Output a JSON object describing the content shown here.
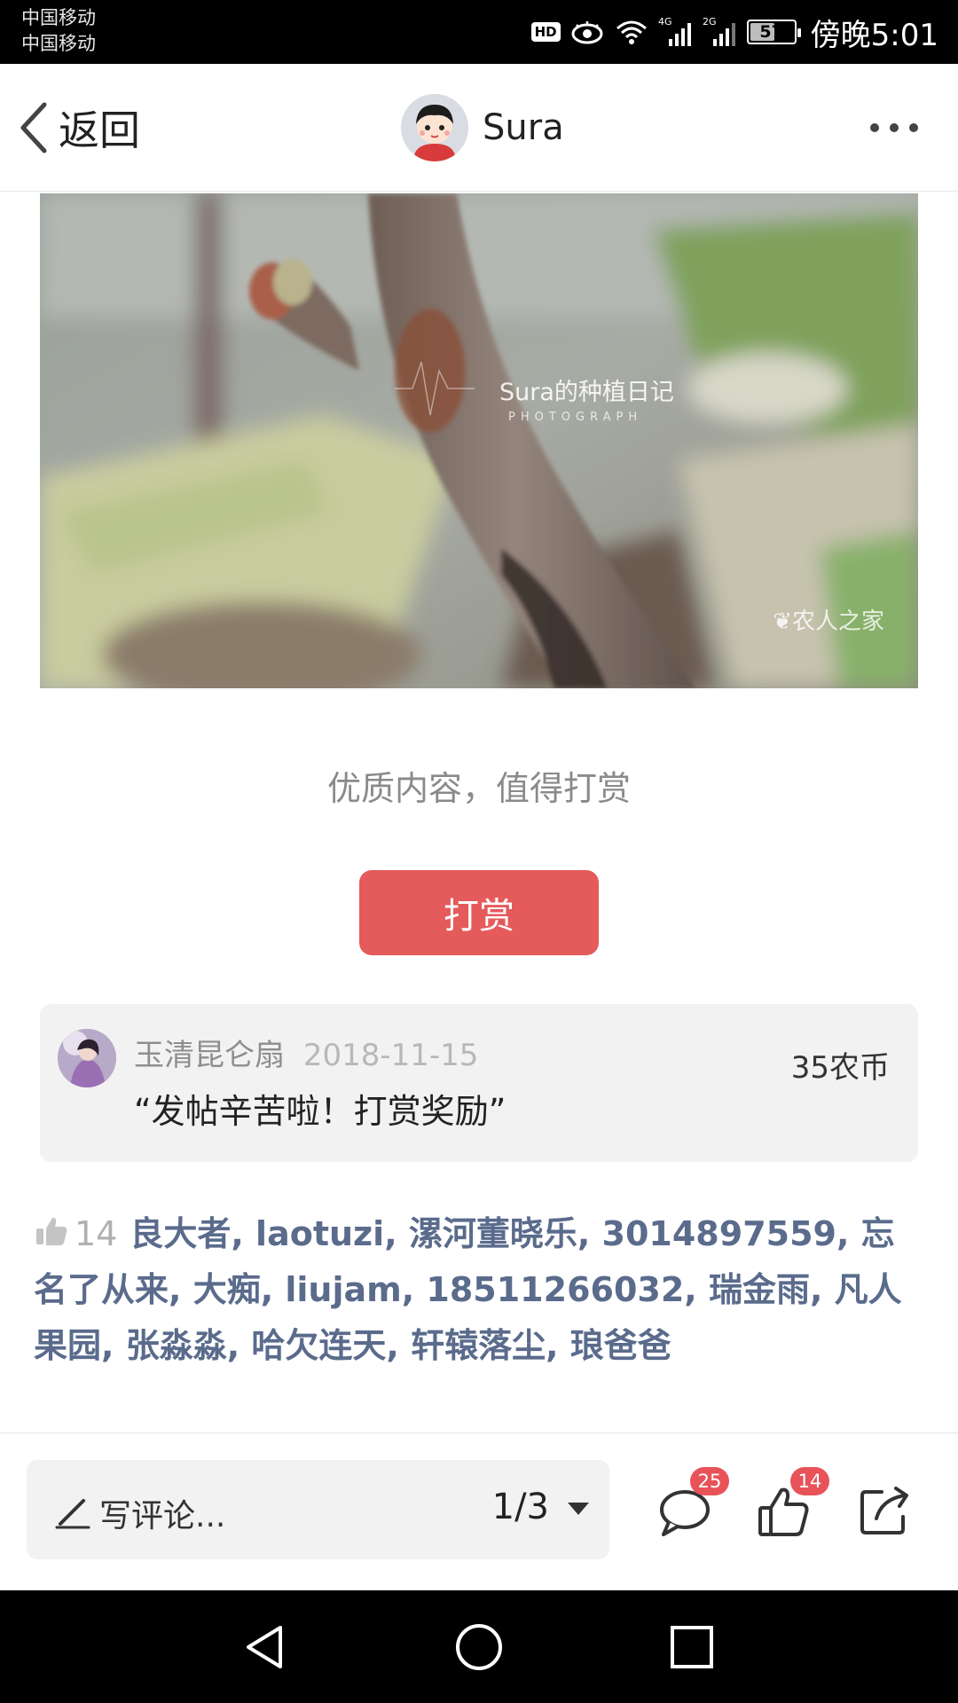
{
  "status_bar": {
    "carrier_1": "中国移动",
    "carrier_2": "中国移动",
    "hd_label": "HD",
    "network_1": "4G",
    "network_2": "2G",
    "battery_level": 57,
    "battery_text": "57",
    "time": "傍晚5:01"
  },
  "header": {
    "back_label": "返回",
    "author_name": "Sura",
    "more_icon": "more-dots-icon"
  },
  "photo": {
    "watermark_title": "Sura的种植日记",
    "watermark_subtitle": "PHOTOGRAPH",
    "site_watermark": "农人之家"
  },
  "reward": {
    "prompt": "优质内容，值得打赏",
    "button_label": "打赏",
    "record": {
      "giver_name": "玉清昆仑扇",
      "date": "2018-11-15",
      "message": "“发帖辛苦啦！打赏奖励”",
      "amount": "35农币"
    }
  },
  "likes": {
    "count": "14",
    "names": [
      "良大者",
      "laotuzi",
      "漯河董晓乐",
      "3014897559",
      "忘名了从来",
      "大痴",
      "liujam",
      "18511266032",
      "瑞金雨",
      "凡人果园",
      "张淼淼",
      "哈欠连天",
      "轩辕落尘",
      "琅爸爸"
    ],
    "separator": ", "
  },
  "bottom_bar": {
    "comment_placeholder": "写评论...",
    "page_indicator": "1/3",
    "comment_count": "25",
    "like_count": "14"
  },
  "colors": {
    "accent_red": "#e55a5a",
    "badge_red": "#e8535a",
    "liker_blue": "#5a6b8c"
  }
}
